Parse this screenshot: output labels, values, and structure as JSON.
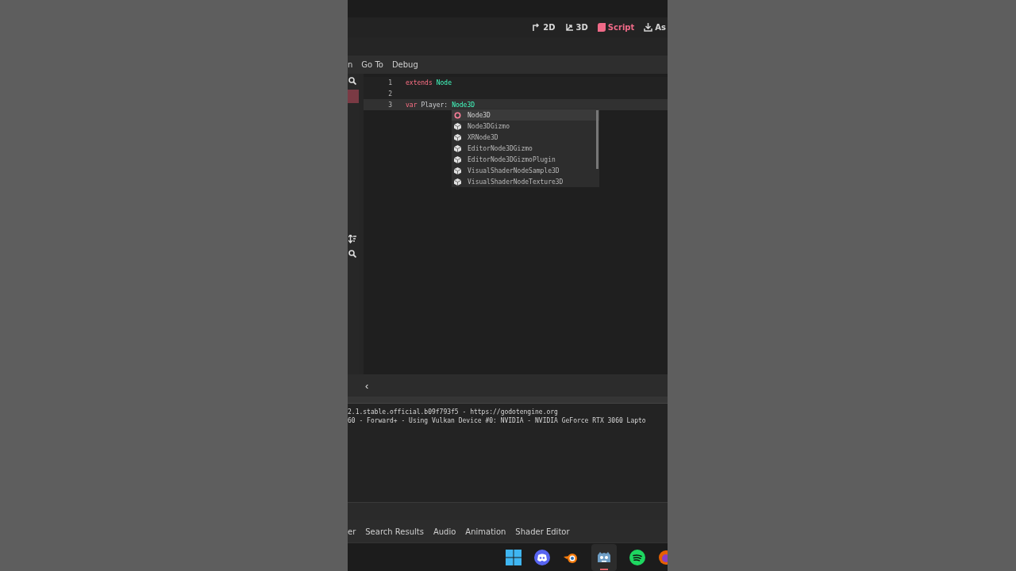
{
  "toolbar": {
    "tabs": [
      {
        "label": "2D",
        "kind": "twod",
        "selected": false
      },
      {
        "label": "3D",
        "kind": "threed",
        "selected": false
      },
      {
        "label": "Script",
        "kind": "script",
        "selected": true
      },
      {
        "label": "As",
        "kind": "assetlib",
        "selected": false
      }
    ]
  },
  "script_menu": [
    "n",
    "Go To",
    "Debug"
  ],
  "editor": {
    "lines": [
      {
        "number": "1",
        "current": false,
        "tokens": [
          {
            "text": "extends",
            "kind": "keyword"
          },
          {
            "text": "Node",
            "kind": "type"
          }
        ]
      },
      {
        "number": "2",
        "current": false
      },
      {
        "number": "3",
        "current": true,
        "tokens": [
          {
            "text": "var",
            "kind": "keyword"
          },
          {
            "text": "Player:",
            "kind": "plain"
          },
          {
            "text": "Node3D",
            "kind": "type"
          }
        ]
      }
    ],
    "completion": [
      {
        "text": "Node3D",
        "kind": "class",
        "selected": true
      },
      {
        "text": "Node3DGizmo",
        "kind": "object",
        "selected": false
      },
      {
        "text": "XRNode3D",
        "kind": "object",
        "selected": false
      },
      {
        "text": "EditorNode3DGizmo",
        "kind": "object",
        "selected": false
      },
      {
        "text": "EditorNode3DGizmoPlugin",
        "kind": "object",
        "selected": false
      },
      {
        "text": "VisualShaderNodeSample3D",
        "kind": "object",
        "selected": false
      },
      {
        "text": "VisualShaderNodeTexture3D",
        "kind": "object",
        "selected": false
      }
    ],
    "collapse_button": "‹"
  },
  "output": [
    "2.1.stable.official.b09f793f5 - https://godotengine.org",
    "60 - Forward+ - Using Vulkan Device #0: NVIDIA - NVIDIA GeForce RTX 3060 Lapto"
  ],
  "bottom_tabs": [
    "er",
    "Search Results",
    "Audio",
    "Animation",
    "Shader Editor"
  ],
  "taskbar": [
    {
      "kind": "windows",
      "selected": false
    },
    {
      "kind": "chat",
      "selected": false
    },
    {
      "kind": "blender",
      "selected": false
    },
    {
      "kind": "godot",
      "selected": true
    },
    {
      "kind": "music",
      "selected": false
    },
    {
      "kind": "browser",
      "selected": false
    }
  ]
}
